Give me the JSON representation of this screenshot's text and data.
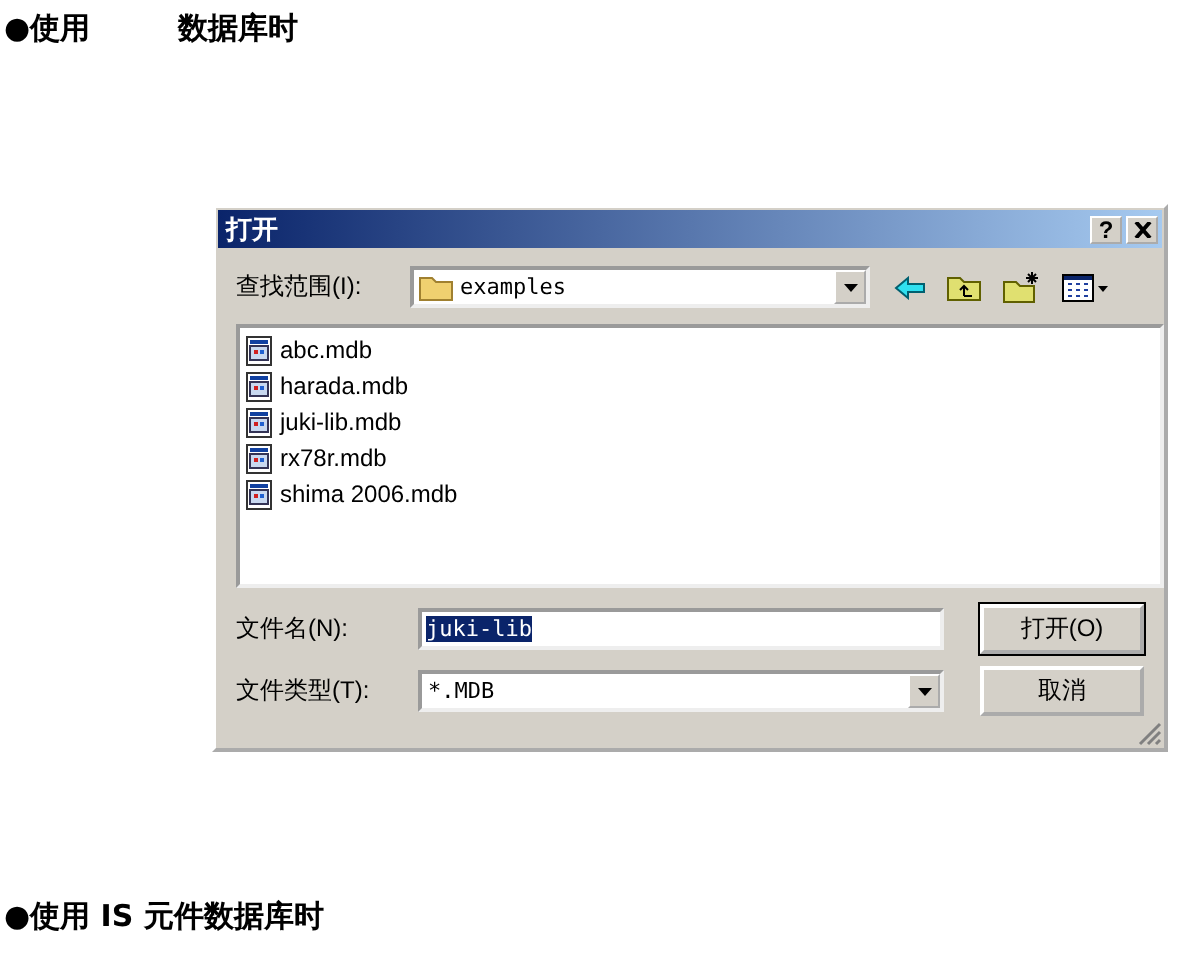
{
  "headings": [
    {
      "parts": [
        "●使用",
        "数据库时"
      ]
    }
  ],
  "dialog": {
    "title": "打开",
    "help_button": "?",
    "look_in": {
      "label": "查找范围(I):",
      "value": "examples"
    },
    "files": [
      {
        "name": "abc.mdb"
      },
      {
        "name": "harada.mdb"
      },
      {
        "name": "juki-lib.mdb"
      },
      {
        "name": "rx78r.mdb"
      },
      {
        "name": "shima 2006.mdb"
      }
    ],
    "file_name": {
      "label": "文件名(N):",
      "value": "juki-lib",
      "text_selected": true
    },
    "file_type": {
      "label": "文件类型(T):",
      "value": "*.MDB"
    },
    "buttons": [
      {
        "label": "打开(O)",
        "default": true
      },
      {
        "label": "取消",
        "default": false
      }
    ]
  },
  "footer_headings": [
    {
      "parts": [
        "●使用 IS 元件数据库时"
      ]
    }
  ]
}
